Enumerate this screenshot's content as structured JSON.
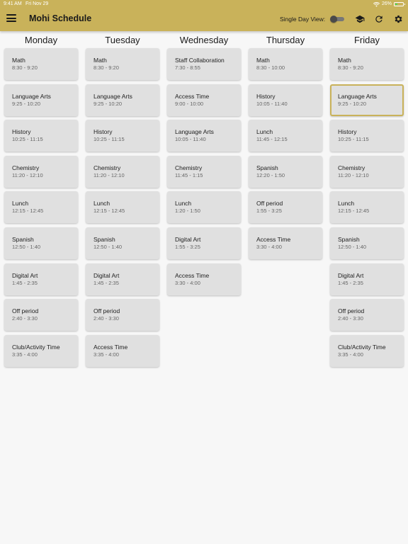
{
  "status": {
    "time": "9:41 AM",
    "date": "Fri Nov 29",
    "battery": "26%"
  },
  "app": {
    "title": "Mohi Schedule",
    "toggle_label": "Single Day View:",
    "toggle_on": false,
    "accent": "#c9b25a"
  },
  "icons": {
    "menu": "menu-icon",
    "school": "school-cap-icon",
    "refresh": "refresh-icon",
    "settings": "gear-icon"
  },
  "days": [
    {
      "name": "Monday",
      "periods": [
        {
          "name": "Math",
          "time": "8:30 - 9:20"
        },
        {
          "name": "Language Arts",
          "time": "9:25 - 10:20"
        },
        {
          "name": "History",
          "time": "10:25 - 11:15"
        },
        {
          "name": "Chemistry",
          "time": "11:20 - 12:10"
        },
        {
          "name": "Lunch",
          "time": "12:15 - 12:45"
        },
        {
          "name": "Spanish",
          "time": "12:50 - 1:40"
        },
        {
          "name": "Digital Art",
          "time": "1:45 - 2:35"
        },
        {
          "name": "Off period",
          "time": "2:40 - 3:30"
        },
        {
          "name": "Club/Activity Time",
          "time": "3:35 - 4:00"
        }
      ]
    },
    {
      "name": "Tuesday",
      "periods": [
        {
          "name": "Math",
          "time": "8:30 - 9:20"
        },
        {
          "name": "Language Arts",
          "time": "9:25 - 10:20"
        },
        {
          "name": "History",
          "time": "10:25 - 11:15"
        },
        {
          "name": "Chemistry",
          "time": "11:20 - 12:10"
        },
        {
          "name": "Lunch",
          "time": "12:15 - 12:45"
        },
        {
          "name": "Spanish",
          "time": "12:50 - 1:40"
        },
        {
          "name": "Digital Art",
          "time": "1:45 - 2:35"
        },
        {
          "name": "Off period",
          "time": "2:40 - 3:30"
        },
        {
          "name": "Access Time",
          "time": "3:35 - 4:00"
        }
      ]
    },
    {
      "name": "Wednesday",
      "periods": [
        {
          "name": "Staff Collaboration",
          "time": "7:30 - 8:55"
        },
        {
          "name": "Access Time",
          "time": "9:00 - 10:00"
        },
        {
          "name": "Language Arts",
          "time": "10:05 - 11:40"
        },
        {
          "name": "Chemistry",
          "time": "11:45 - 1:15"
        },
        {
          "name": "Lunch",
          "time": "1:20 - 1:50"
        },
        {
          "name": "Digital Art",
          "time": "1:55 - 3:25"
        },
        {
          "name": "Access Time",
          "time": "3:30 - 4:00"
        }
      ]
    },
    {
      "name": "Thursday",
      "periods": [
        {
          "name": "Math",
          "time": "8:30 - 10:00"
        },
        {
          "name": "History",
          "time": "10:05 - 11:40"
        },
        {
          "name": "Lunch",
          "time": "11:45 - 12:15"
        },
        {
          "name": "Spanish",
          "time": "12:20 - 1:50"
        },
        {
          "name": "Off period",
          "time": "1:55 - 3:25"
        },
        {
          "name": "Access Time",
          "time": "3:30 - 4:00"
        }
      ]
    },
    {
      "name": "Friday",
      "periods": [
        {
          "name": "Math",
          "time": "8:30 - 9:20"
        },
        {
          "name": "Language Arts",
          "time": "9:25 - 10:20",
          "current": true
        },
        {
          "name": "History",
          "time": "10:25 - 11:15"
        },
        {
          "name": "Chemistry",
          "time": "11:20 - 12:10"
        },
        {
          "name": "Lunch",
          "time": "12:15 - 12:45"
        },
        {
          "name": "Spanish",
          "time": "12:50 - 1:40"
        },
        {
          "name": "Digital Art",
          "time": "1:45 - 2:35"
        },
        {
          "name": "Off period",
          "time": "2:40 - 3:30"
        },
        {
          "name": "Club/Activity Time",
          "time": "3:35 - 4:00"
        }
      ]
    }
  ]
}
